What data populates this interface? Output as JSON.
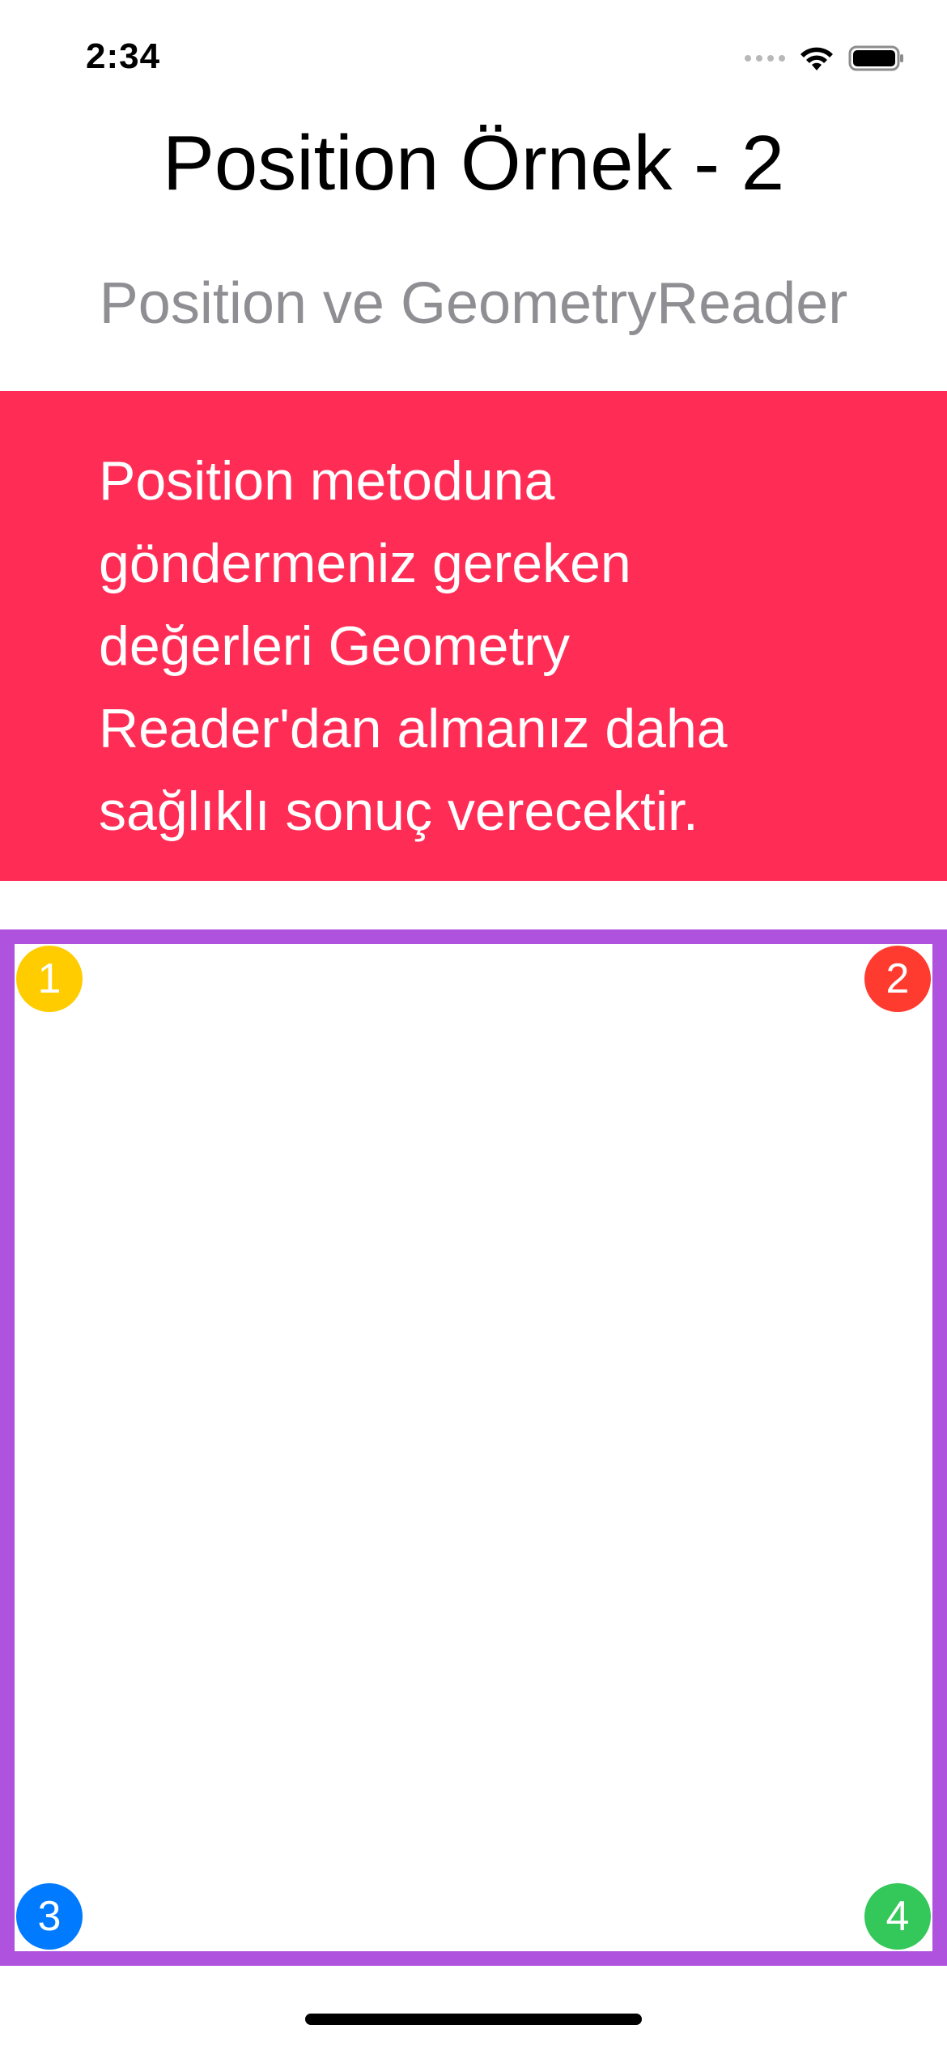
{
  "status_bar": {
    "time": "2:34",
    "icons": [
      "signal-icon",
      "wifi-icon",
      "battery-icon"
    ]
  },
  "header": {
    "title": "Position Örnek - 2",
    "subtitle": "Position ve GeometryReader"
  },
  "banner": {
    "text": "Position metoduna göndermeniz gereken değerleri Geometry Reader'dan almanız daha sağlıklı sonuç verecektir.",
    "background_color": "#ff2d55"
  },
  "frame": {
    "border_color": "#af52de",
    "badges": [
      {
        "label": "1",
        "color": "#ffcc00"
      },
      {
        "label": "2",
        "color": "#ff3b30"
      },
      {
        "label": "3",
        "color": "#007aff"
      },
      {
        "label": "4",
        "color": "#34c759"
      }
    ]
  }
}
